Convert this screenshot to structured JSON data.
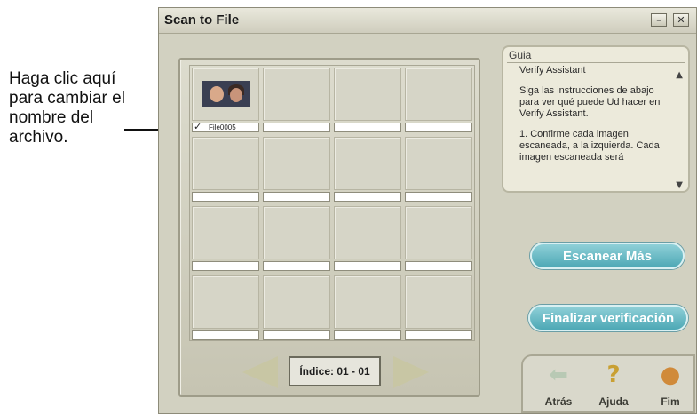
{
  "annotation": {
    "callout_text": "Haga clic aquí para cambiar el nombre del archivo."
  },
  "window": {
    "title": "Scan to File",
    "minimize_glyph": "–",
    "close_glyph": "✕"
  },
  "grid": {
    "first_item": {
      "checked": true,
      "check_glyph": "✓",
      "filename": "File0005"
    }
  },
  "navigation": {
    "index_label": "Índice: 01 - 01"
  },
  "guide": {
    "header": "Guia",
    "title": "Verify Assistant",
    "para1": "Siga las instrucciones de abajo para ver qué puede Ud hacer en Verify Assistant.",
    "para2": "1. Confirme cada imagen escaneada, a la izquierda. Cada imagen escaneada será",
    "scroll_up_glyph": "▲",
    "scroll_down_glyph": "▼"
  },
  "buttons": {
    "scan_more": "Escanear Más",
    "finalize": "Finalizar verificación"
  },
  "bottom_nav": {
    "back": {
      "label": "Atrás",
      "icon": "back-arrow-icon",
      "glyph": "⬅"
    },
    "help": {
      "label": "Ajuda",
      "icon": "question-icon",
      "glyph": "?"
    },
    "finish": {
      "label": "Fim",
      "icon": "finish-ball-icon",
      "glyph": "●"
    }
  },
  "colors": {
    "window_bg": "#d2d1c1",
    "button_teal": "#4da8b5",
    "arrow_khaki": "#c8c6a4"
  }
}
